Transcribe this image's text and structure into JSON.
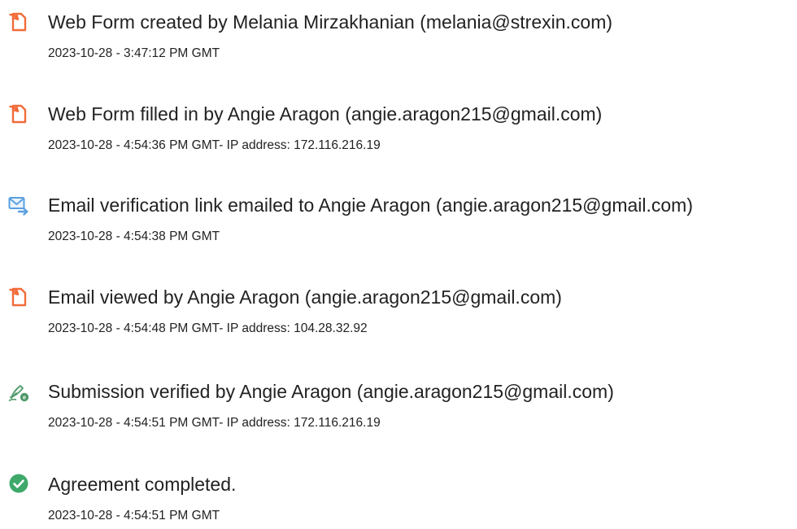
{
  "events": [
    {
      "icon": "document-icon",
      "title": "Web Form created by Melania Mirzakhanian (melania@strexin.com)",
      "meta": "2023-10-28 - 3:47:12 PM GMT"
    },
    {
      "icon": "document-icon",
      "title": "Web Form filled in by Angie Aragon (angie.aragon215@gmail.com)",
      "meta": "2023-10-28 - 4:54:36 PM GMT- IP address: 172.116.216.19"
    },
    {
      "icon": "email-send-icon",
      "title": "Email verification link emailed to Angie Aragon (angie.aragon215@gmail.com)",
      "meta": "2023-10-28 - 4:54:38 PM GMT"
    },
    {
      "icon": "document-icon",
      "title": "Email viewed by Angie Aragon (angie.aragon215@gmail.com)",
      "meta": "2023-10-28 - 4:54:48 PM GMT- IP address: 104.28.32.92"
    },
    {
      "icon": "verified-pen-icon",
      "title": "Submission verified by Angie Aragon (angie.aragon215@gmail.com)",
      "meta": "2023-10-28 - 4:54:51 PM GMT- IP address: 172.116.216.19"
    },
    {
      "icon": "checkmark-circle-icon",
      "title": "Agreement completed.",
      "meta": "2023-10-28 - 4:54:51 PM GMT"
    }
  ],
  "colors": {
    "document_icon": "#f26b3a",
    "email_icon": "#5aa0e0",
    "pen_icon": "#4f9a6a",
    "check_icon": "#3fa86b",
    "text": "#222222"
  }
}
